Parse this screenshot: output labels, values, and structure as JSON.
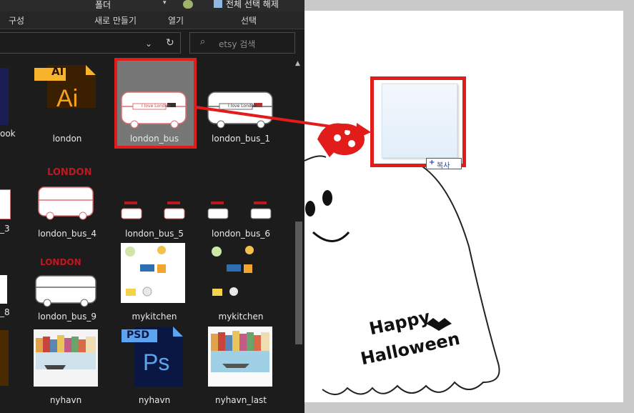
{
  "ribbon": {
    "partial_text": "",
    "folder_label": "폴더",
    "select_all_label": "전체 선택 해제",
    "groups": [
      "구성",
      "새로 만들기",
      "열기",
      "선택"
    ]
  },
  "address": {
    "search_placeholder": "etsy 검색"
  },
  "files": [
    {
      "label": "london",
      "icon": "illustrator-file-icon",
      "badge": "AI",
      "letters": "Ai"
    },
    {
      "label": "london_bus",
      "icon": "london-bus-thumb",
      "selected": true
    },
    {
      "label": "london_bus_1",
      "icon": "london-bus-thumb"
    },
    {
      "label": "london_bus_4",
      "icon": "london-poster-thumb"
    },
    {
      "label": "london_bus_5",
      "icon": "london-bus-small-thumb"
    },
    {
      "label": "london_bus_6",
      "icon": "london-bus-small-thumb"
    },
    {
      "label": "london_bus_9",
      "icon": "london-poster-thumb"
    },
    {
      "label": "mykitchen",
      "icon": "kitchen-thumb"
    },
    {
      "label": "mykitchen",
      "icon": "kitchen-dark-thumb"
    },
    {
      "label": "nyhavn",
      "icon": "nyhavn-photo-thumb"
    },
    {
      "label": "nyhavn",
      "icon": "photoshop-file-icon",
      "badge": "PSD",
      "letters": "Ps"
    },
    {
      "label": "nyhavn_last",
      "icon": "nyhavn-photo-thumb"
    }
  ],
  "left_partial_labels": [
    "ook",
    "_3",
    "_8"
  ],
  "bus_text": "I love London",
  "poster_title": "LONDON",
  "canvas": {
    "drop_tooltip": "+ 복사",
    "drop_tooltip_text": "복사",
    "artwork": "Happy Halloween",
    "artwork_line1": "Happy",
    "artwork_line2": "Halloween"
  },
  "colors": {
    "highlight_red": "#e21b1b",
    "explorer_bg": "#1c1c1c"
  }
}
